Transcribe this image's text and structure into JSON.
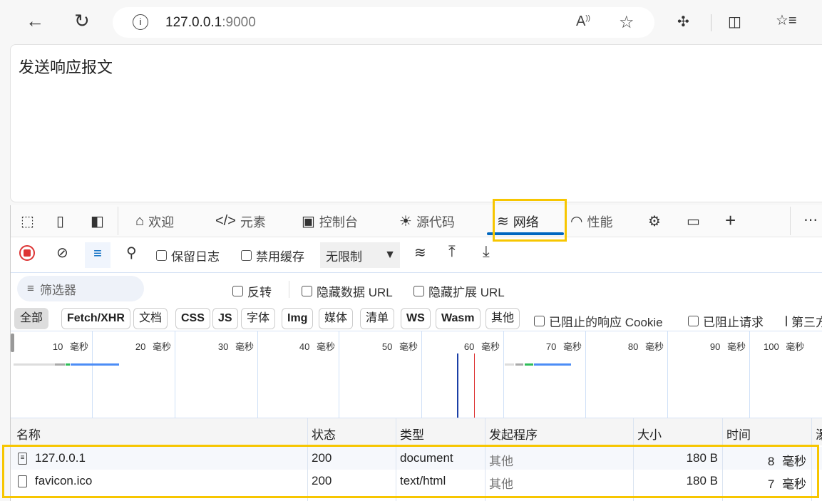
{
  "browser": {
    "url_host": "127.0.0.1",
    "url_port": ":9000",
    "icons": [
      "back-icon",
      "refresh-icon",
      "info-icon",
      "read-aloud-icon",
      "favorite-icon",
      "extensions-icon",
      "split-screen-icon",
      "favorites-icon"
    ]
  },
  "page": {
    "heading": "发送响应报文"
  },
  "devtools": {
    "tabs": [
      {
        "label": "欢迎",
        "icon": "home-icon"
      },
      {
        "label": "元素",
        "icon": "code-icon"
      },
      {
        "label": "控制台",
        "icon": "console-icon"
      },
      {
        "label": "源代码",
        "icon": "bug-icon"
      },
      {
        "label": "网络",
        "icon": "wifi-icon",
        "active": true
      },
      {
        "label": "性能",
        "icon": "gauge-icon"
      }
    ],
    "accent": "#0067c0",
    "toolbar": {
      "preserve_log": "保留日志",
      "disable_cache": "禁用缓存",
      "throttle": "无限制"
    },
    "filter": {
      "placeholder": "筛选器",
      "invert": "反转",
      "hide_data_url": "隐藏数据 URL",
      "hide_ext_url": "隐藏扩展 URL"
    },
    "types": [
      "全部",
      "Fetch/XHR",
      "文档",
      "CSS",
      "JS",
      "字体",
      "Img",
      "媒体",
      "清单",
      "WS",
      "Wasm",
      "其他"
    ],
    "type_checks": [
      "已阻止的响应 Cookie",
      "已阻止请求",
      "第三方请求"
    ],
    "timeline_ticks": [
      "10 毫秒",
      "20 毫秒",
      "30 毫秒",
      "40 毫秒",
      "50 毫秒",
      "60 毫秒",
      "70 毫秒",
      "80 毫秒",
      "90 毫秒",
      "100 毫秒"
    ],
    "columns": [
      "名称",
      "状态",
      "类型",
      "发起程序",
      "大小",
      "时间",
      "瀑布"
    ],
    "rows": [
      {
        "name": "127.0.0.1",
        "status": "200",
        "type": "document",
        "initiator": "其他",
        "size": "180 B",
        "time": "8 毫秒"
      },
      {
        "name": "favicon.ico",
        "status": "200",
        "type": "text/html",
        "initiator": "其他",
        "size": "180 B",
        "time": "7 毫秒"
      }
    ]
  }
}
